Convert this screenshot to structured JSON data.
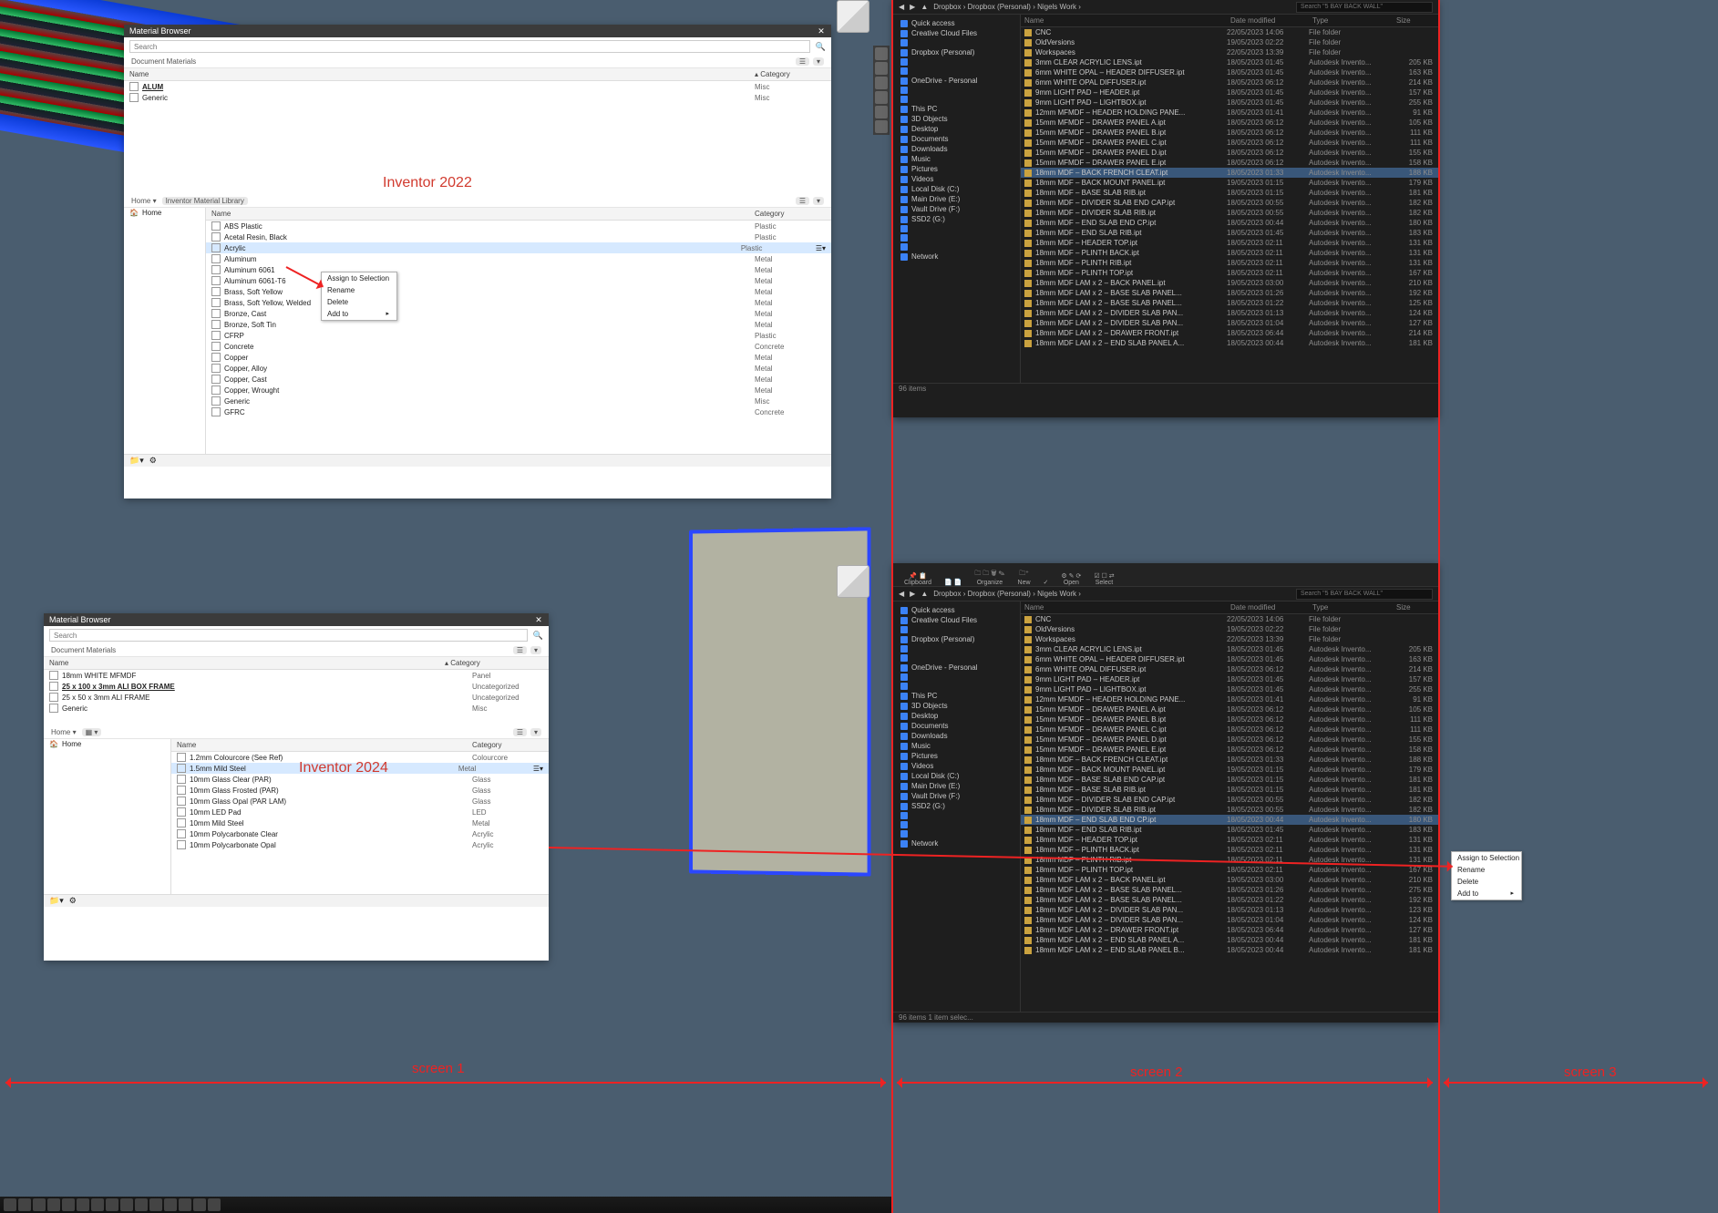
{
  "captions": {
    "inv2022": "Inventor 2022",
    "inv2024": "Inventor 2024"
  },
  "screen_labels": {
    "s1": "screen 1",
    "s2": "screen 2",
    "s3": "screen 3"
  },
  "mat2022": {
    "title": "Material Browser",
    "search_ph": "Search",
    "docmat_label": "Document Materials",
    "cols": {
      "name": "Name",
      "cat": "Category"
    },
    "docmats": [
      {
        "n": "ALUM",
        "c": "Misc",
        "bold": true
      },
      {
        "n": "Generic",
        "c": "Misc"
      }
    ],
    "library_label": "Inventor Material Library",
    "home": "Home",
    "libmats": [
      {
        "n": "ABS Plastic",
        "c": "Plastic"
      },
      {
        "n": "Acetal Resin, Black",
        "c": "Plastic"
      },
      {
        "n": "Acrylic",
        "c": "Plastic",
        "hl": true
      },
      {
        "n": "Aluminum",
        "c": "Metal"
      },
      {
        "n": "Aluminum 6061",
        "c": "Metal"
      },
      {
        "n": "Aluminum 6061-T6",
        "c": "Metal"
      },
      {
        "n": "Brass, Soft Yellow",
        "c": "Metal"
      },
      {
        "n": "Brass, Soft Yellow, Welded",
        "c": "Metal"
      },
      {
        "n": "Bronze, Cast",
        "c": "Metal"
      },
      {
        "n": "Bronze, Soft Tin",
        "c": "Metal"
      },
      {
        "n": "CFRP",
        "c": "Plastic"
      },
      {
        "n": "Concrete",
        "c": "Concrete"
      },
      {
        "n": "Copper",
        "c": "Metal"
      },
      {
        "n": "Copper, Alloy",
        "c": "Metal"
      },
      {
        "n": "Copper, Cast",
        "c": "Metal"
      },
      {
        "n": "Copper, Wrought",
        "c": "Metal"
      },
      {
        "n": "Generic",
        "c": "Misc"
      },
      {
        "n": "GFRC",
        "c": "Concrete"
      }
    ],
    "ctx": [
      "Assign to Selection",
      "Rename",
      "Delete",
      "Add to"
    ]
  },
  "mat2024": {
    "title": "Material Browser",
    "search_ph": "Search",
    "docmat_label": "Document Materials",
    "cols": {
      "name": "Name",
      "cat": "Category"
    },
    "docmats": [
      {
        "n": "18mm WHITE MFMDF",
        "c": "Panel"
      },
      {
        "n": "25 x 100 x 3mm ALI BOX FRAME",
        "c": "Uncategorized",
        "bold": true
      },
      {
        "n": "25 x 50 x 3mm ALI FRAME",
        "c": "Uncategorized"
      },
      {
        "n": "Generic",
        "c": "Misc"
      }
    ],
    "home": "Home",
    "libmats": [
      {
        "n": "1.2mm Colourcore (See Ref)",
        "c": "Colourcore"
      },
      {
        "n": "1.5mm Mild Steel",
        "c": "Metal",
        "hl": true
      },
      {
        "n": "10mm Glass Clear (PAR)",
        "c": "Glass"
      },
      {
        "n": "10mm Glass Frosted (PAR)",
        "c": "Glass"
      },
      {
        "n": "10mm Glass Opal (PAR LAM)",
        "c": "Glass"
      },
      {
        "n": "10mm LED Pad",
        "c": "LED"
      },
      {
        "n": "10mm Mild Steel",
        "c": "Metal"
      },
      {
        "n": "10mm Polycarbonate Clear",
        "c": "Acrylic"
      },
      {
        "n": "10mm Polycarbonate Opal",
        "c": "Acrylic"
      }
    ]
  },
  "ctx_remote": {
    "items": [
      "Assign to Selection",
      "Rename",
      "Delete",
      "Add to"
    ]
  },
  "explorer": {
    "ribbon": [
      [
        "Pin to Quick access",
        "Copy",
        "Paste"
      ],
      [
        "Copy path",
        "Paste shortcut"
      ],
      [
        "Move to",
        "Copy to"
      ],
      [
        "Delete",
        "Rename"
      ],
      [
        "New folder"
      ],
      [
        "Easy access"
      ],
      [
        "Properties"
      ],
      [
        "Edit",
        "History"
      ],
      [
        "Select none",
        "Invert selection"
      ]
    ],
    "ribbon_groups": [
      "Clipboard",
      "",
      "Organize",
      "",
      "New",
      "",
      "Open",
      "",
      "Select"
    ],
    "crumbs": [
      " ",
      "Dropbox",
      "Dropbox (Personal)",
      "Nigels Work"
    ],
    "search_ph": "Search \"5 BAY BACK WALL\"",
    "nav": [
      "Quick access",
      "Creative Cloud Files",
      "",
      "Dropbox (Personal)",
      "",
      "",
      "OneDrive - Personal",
      "",
      "",
      "This PC",
      "3D Objects",
      "Desktop",
      "Documents",
      "Downloads",
      "Music",
      "Pictures",
      "Videos",
      "Local Disk (C:)",
      "Main Drive (E:)",
      "Vault Drive (F:)",
      "SSD2 (G:)",
      "",
      "",
      "",
      "Network"
    ],
    "cols": {
      "name": "Name",
      "date": "Date modified",
      "type": "Type",
      "size": "Size"
    },
    "rows": [
      {
        "n": "CNC",
        "d": "22/05/2023 14:06",
        "t": "File folder",
        "s": ""
      },
      {
        "n": "OldVersions",
        "d": "19/05/2023 02:22",
        "t": "File folder",
        "s": ""
      },
      {
        "n": "Workspaces",
        "d": "22/05/2023 13:39",
        "t": "File folder",
        "s": ""
      },
      {
        "n": "3mm CLEAR ACRYLIC LENS.ipt",
        "d": "18/05/2023 01:45",
        "t": "Autodesk Invento...",
        "s": "205 KB"
      },
      {
        "n": "6mm WHITE OPAL – HEADER DIFFUSER.ipt",
        "d": "18/05/2023 01:45",
        "t": "Autodesk Invento...",
        "s": "163 KB"
      },
      {
        "n": "6mm WHITE OPAL DIFFUSER.ipt",
        "d": "18/05/2023 06:12",
        "t": "Autodesk Invento...",
        "s": "214 KB"
      },
      {
        "n": "9mm LIGHT PAD – HEADER.ipt",
        "d": "18/05/2023 01:45",
        "t": "Autodesk Invento...",
        "s": "157 KB"
      },
      {
        "n": "9mm LIGHT PAD – LIGHTBOX.ipt",
        "d": "18/05/2023 01:45",
        "t": "Autodesk Invento...",
        "s": "255 KB"
      },
      {
        "n": "12mm MFMDF – HEADER HOLDING PANE...",
        "d": "18/05/2023 01:41",
        "t": "Autodesk Invento...",
        "s": "91 KB"
      },
      {
        "n": "15mm MFMDF – DRAWER PANEL A.ipt",
        "d": "18/05/2023 06:12",
        "t": "Autodesk Invento...",
        "s": "105 KB"
      },
      {
        "n": "15mm MFMDF – DRAWER PANEL B.ipt",
        "d": "18/05/2023 06:12",
        "t": "Autodesk Invento...",
        "s": "111 KB"
      },
      {
        "n": "15mm MFMDF – DRAWER PANEL C.ipt",
        "d": "18/05/2023 06:12",
        "t": "Autodesk Invento...",
        "s": "111 KB"
      },
      {
        "n": "15mm MFMDF – DRAWER PANEL D.ipt",
        "d": "18/05/2023 06:12",
        "t": "Autodesk Invento...",
        "s": "155 KB"
      },
      {
        "n": "15mm MFMDF – DRAWER PANEL E.ipt",
        "d": "18/05/2023 06:12",
        "t": "Autodesk Invento...",
        "s": "158 KB"
      },
      {
        "n": "18mm MDF – BACK FRENCH CLEAT.ipt",
        "d": "18/05/2023 01:33",
        "t": "Autodesk Invento...",
        "s": "188 KB",
        "sel": true
      },
      {
        "n": "18mm MDF – BACK MOUNT PANEL.ipt",
        "d": "19/05/2023 01:15",
        "t": "Autodesk Invento...",
        "s": "179 KB"
      },
      {
        "n": "18mm MDF – BASE SLAB RIB.ipt",
        "d": "18/05/2023 01:15",
        "t": "Autodesk Invento...",
        "s": "181 KB"
      },
      {
        "n": "18mm MDF – DIVIDER SLAB END CAP.ipt",
        "d": "18/05/2023 00:55",
        "t": "Autodesk Invento...",
        "s": "182 KB"
      },
      {
        "n": "18mm MDF – DIVIDER SLAB RIB.ipt",
        "d": "18/05/2023 00:55",
        "t": "Autodesk Invento...",
        "s": "182 KB"
      },
      {
        "n": "18mm MDF – END SLAB END CP.ipt",
        "d": "18/05/2023 00:44",
        "t": "Autodesk Invento...",
        "s": "180 KB"
      },
      {
        "n": "18mm MDF – END SLAB RIB.ipt",
        "d": "18/05/2023 01:45",
        "t": "Autodesk Invento...",
        "s": "183 KB"
      },
      {
        "n": "18mm MDF – HEADER TOP.ipt",
        "d": "18/05/2023 02:11",
        "t": "Autodesk Invento...",
        "s": "131 KB"
      },
      {
        "n": "18mm MDF – PLINTH BACK.ipt",
        "d": "18/05/2023 02:11",
        "t": "Autodesk Invento...",
        "s": "131 KB"
      },
      {
        "n": "18mm MDF – PLINTH RIB.ipt",
        "d": "18/05/2023 02:11",
        "t": "Autodesk Invento...",
        "s": "131 KB"
      },
      {
        "n": "18mm MDF – PLINTH TOP.ipt",
        "d": "18/05/2023 02:11",
        "t": "Autodesk Invento...",
        "s": "167 KB"
      },
      {
        "n": "18mm MDF LAM x 2 – BACK PANEL.ipt",
        "d": "19/05/2023 03:00",
        "t": "Autodesk Invento...",
        "s": "210 KB"
      },
      {
        "n": "18mm MDF LAM x 2 – BASE SLAB PANEL...",
        "d": "18/05/2023 01:26",
        "t": "Autodesk Invento...",
        "s": "192 KB"
      },
      {
        "n": "18mm MDF LAM x 2 – BASE SLAB PANEL...",
        "d": "18/05/2023 01:22",
        "t": "Autodesk Invento...",
        "s": "125 KB"
      },
      {
        "n": "18mm MDF LAM x 2 – DIVIDER SLAB PAN...",
        "d": "18/05/2023 01:13",
        "t": "Autodesk Invento...",
        "s": "124 KB"
      },
      {
        "n": "18mm MDF LAM x 2 – DIVIDER SLAB PAN...",
        "d": "18/05/2023 01:04",
        "t": "Autodesk Invento...",
        "s": "127 KB"
      },
      {
        "n": "18mm MDF LAM x 2 – DRAWER FRONT.ipt",
        "d": "18/05/2023 06:44",
        "t": "Autodesk Invento...",
        "s": "214 KB"
      },
      {
        "n": "18mm MDF LAM x 2 – END SLAB PANEL A...",
        "d": "18/05/2023 00:44",
        "t": "Autodesk Invento...",
        "s": "181 KB"
      }
    ],
    "status": "96 items"
  },
  "explorer2_rows": [
    {
      "n": "CNC",
      "d": "22/05/2023 14:06",
      "t": "File folder",
      "s": ""
    },
    {
      "n": "OldVersions",
      "d": "19/05/2023 02:22",
      "t": "File folder",
      "s": ""
    },
    {
      "n": "Workspaces",
      "d": "22/05/2023 13:39",
      "t": "File folder",
      "s": ""
    },
    {
      "n": "3mm CLEAR ACRYLIC LENS.ipt",
      "d": "18/05/2023 01:45",
      "t": "Autodesk Invento...",
      "s": "205 KB"
    },
    {
      "n": "6mm WHITE OPAL – HEADER DIFFUSER.ipt",
      "d": "18/05/2023 01:45",
      "t": "Autodesk Invento...",
      "s": "163 KB"
    },
    {
      "n": "6mm WHITE OPAL DIFFUSER.ipt",
      "d": "18/05/2023 06:12",
      "t": "Autodesk Invento...",
      "s": "214 KB"
    },
    {
      "n": "9mm LIGHT PAD – HEADER.ipt",
      "d": "18/05/2023 01:45",
      "t": "Autodesk Invento...",
      "s": "157 KB"
    },
    {
      "n": "9mm LIGHT PAD – LIGHTBOX.ipt",
      "d": "18/05/2023 01:45",
      "t": "Autodesk Invento...",
      "s": "255 KB"
    },
    {
      "n": "12mm MFMDF – HEADER HOLDING PANE...",
      "d": "18/05/2023 01:41",
      "t": "Autodesk Invento...",
      "s": "91 KB"
    },
    {
      "n": "15mm MFMDF – DRAWER PANEL A.ipt",
      "d": "18/05/2023 06:12",
      "t": "Autodesk Invento...",
      "s": "105 KB"
    },
    {
      "n": "15mm MFMDF – DRAWER PANEL B.ipt",
      "d": "18/05/2023 06:12",
      "t": "Autodesk Invento...",
      "s": "111 KB"
    },
    {
      "n": "15mm MFMDF – DRAWER PANEL C.ipt",
      "d": "18/05/2023 06:12",
      "t": "Autodesk Invento...",
      "s": "111 KB"
    },
    {
      "n": "15mm MFMDF – DRAWER PANEL D.ipt",
      "d": "18/05/2023 06:12",
      "t": "Autodesk Invento...",
      "s": "155 KB"
    },
    {
      "n": "15mm MFMDF – DRAWER PANEL E.ipt",
      "d": "18/05/2023 06:12",
      "t": "Autodesk Invento...",
      "s": "158 KB"
    },
    {
      "n": "18mm MDF – BACK FRENCH CLEAT.ipt",
      "d": "18/05/2023 01:33",
      "t": "Autodesk Invento...",
      "s": "188 KB"
    },
    {
      "n": "18mm MDF – BACK MOUNT PANEL.ipt",
      "d": "19/05/2023 01:15",
      "t": "Autodesk Invento...",
      "s": "179 KB"
    },
    {
      "n": "18mm MDF – BASE SLAB END CAP.ipt",
      "d": "18/05/2023 01:15",
      "t": "Autodesk Invento...",
      "s": "181 KB"
    },
    {
      "n": "18mm MDF – BASE SLAB RIB.ipt",
      "d": "18/05/2023 01:15",
      "t": "Autodesk Invento...",
      "s": "181 KB"
    },
    {
      "n": "18mm MDF – DIVIDER SLAB END CAP.ipt",
      "d": "18/05/2023 00:55",
      "t": "Autodesk Invento...",
      "s": "182 KB"
    },
    {
      "n": "18mm MDF – DIVIDER SLAB RIB.ipt",
      "d": "18/05/2023 00:55",
      "t": "Autodesk Invento...",
      "s": "182 KB"
    },
    {
      "n": "18mm MDF – END SLAB END CP.ipt",
      "d": "18/05/2023 00:44",
      "t": "Autodesk Invento...",
      "s": "180 KB",
      "sel": true
    },
    {
      "n": "18mm MDF – END SLAB RIB.ipt",
      "d": "18/05/2023 01:45",
      "t": "Autodesk Invento...",
      "s": "183 KB"
    },
    {
      "n": "18mm MDF – HEADER TOP.ipt",
      "d": "18/05/2023 02:11",
      "t": "Autodesk Invento...",
      "s": "131 KB"
    },
    {
      "n": "18mm MDF – PLINTH BACK.ipt",
      "d": "18/05/2023 02:11",
      "t": "Autodesk Invento...",
      "s": "131 KB"
    },
    {
      "n": "18mm MDF – PLINTH RIB.ipt",
      "d": "18/05/2023 02:11",
      "t": "Autodesk Invento...",
      "s": "131 KB"
    },
    {
      "n": "18mm MDF – PLINTH TOP.ipt",
      "d": "18/05/2023 02:11",
      "t": "Autodesk Invento...",
      "s": "167 KB"
    },
    {
      "n": "18mm MDF LAM x 2 – BACK PANEL.ipt",
      "d": "19/05/2023 03:00",
      "t": "Autodesk Invento...",
      "s": "210 KB"
    },
    {
      "n": "18mm MDF LAM x 2 – BASE SLAB PANEL...",
      "d": "18/05/2023 01:26",
      "t": "Autodesk Invento...",
      "s": "275 KB"
    },
    {
      "n": "18mm MDF LAM x 2 – BASE SLAB PANEL...",
      "d": "18/05/2023 01:22",
      "t": "Autodesk Invento...",
      "s": "192 KB"
    },
    {
      "n": "18mm MDF LAM x 2 – DIVIDER SLAB PAN...",
      "d": "18/05/2023 01:13",
      "t": "Autodesk Invento...",
      "s": "123 KB"
    },
    {
      "n": "18mm MDF LAM x 2 – DIVIDER SLAB PAN...",
      "d": "18/05/2023 01:04",
      "t": "Autodesk Invento...",
      "s": "124 KB"
    },
    {
      "n": "18mm MDF LAM x 2 – DRAWER FRONT.ipt",
      "d": "18/05/2023 06:44",
      "t": "Autodesk Invento...",
      "s": "127 KB"
    },
    {
      "n": "18mm MDF LAM x 2 – END SLAB PANEL A...",
      "d": "18/05/2023 00:44",
      "t": "Autodesk Invento...",
      "s": "181 KB"
    },
    {
      "n": "18mm MDF LAM x 2 – END SLAB PANEL B...",
      "d": "18/05/2023 00:44",
      "t": "Autodesk Invento...",
      "s": "181 KB"
    }
  ],
  "explorer2_status": "96 items   1 item selec..."
}
